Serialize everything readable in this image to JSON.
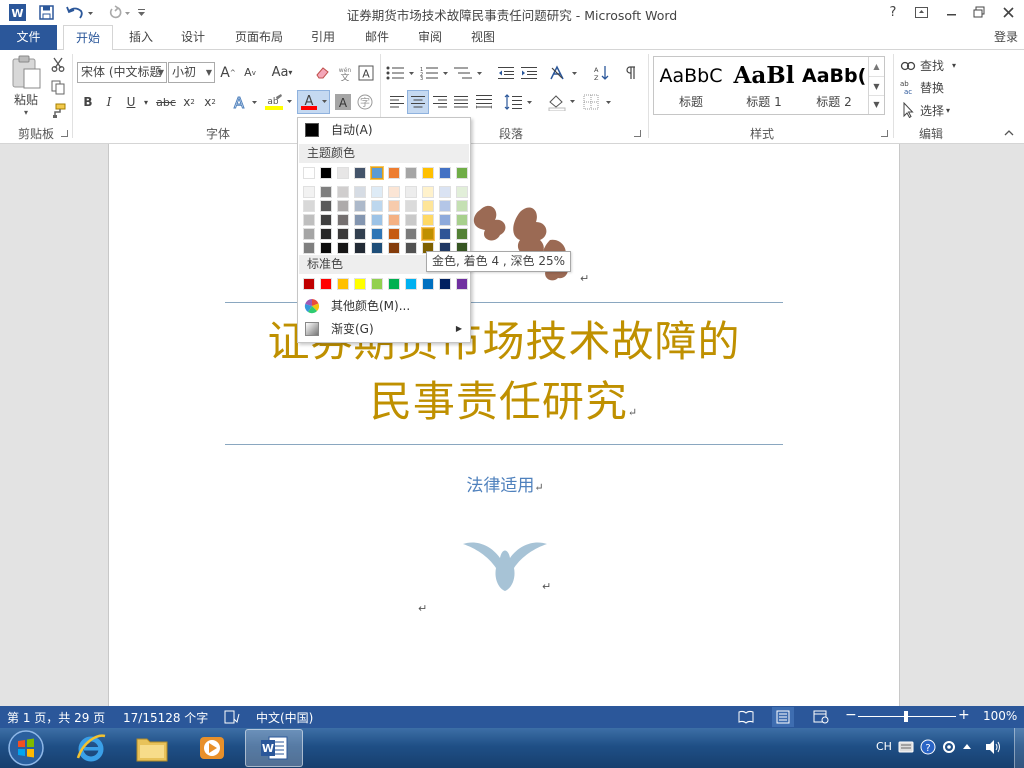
{
  "window": {
    "title": "证券期货市场技术故障民事责任问题研究 - Microsoft Word",
    "help_glyph": "?",
    "login": "登录"
  },
  "tabs": [
    {
      "label": "文件"
    },
    {
      "label": "开始"
    },
    {
      "label": "插入"
    },
    {
      "label": "设计"
    },
    {
      "label": "页面布局"
    },
    {
      "label": "引用"
    },
    {
      "label": "邮件"
    },
    {
      "label": "审阅"
    },
    {
      "label": "视图"
    }
  ],
  "ribbon": {
    "clipboard": {
      "paste_label": "粘贴",
      "group_label": "剪贴板"
    },
    "font": {
      "font_name": "宋体 (中文标题",
      "font_size": "小初",
      "grow_label": "A",
      "shrink_label": "A",
      "case_label": "Aa",
      "bold": "B",
      "italic": "I",
      "underline": "U",
      "strike": "abc",
      "subscript": "x",
      "superscript": "x",
      "group_label": "字体"
    },
    "paragraph": {
      "group_label": "段落"
    },
    "styles": {
      "items": [
        {
          "sample": "AaBbC",
          "name": "标题"
        },
        {
          "sample": "AaBl",
          "name": "标题 1"
        },
        {
          "sample": "AaBb(",
          "name": "标题 2"
        }
      ],
      "group_label": "样式"
    },
    "editing": {
      "find": "查找",
      "replace": "替换",
      "select": "选择",
      "group_label": "编辑"
    }
  },
  "color_menu": {
    "auto_label": "自动(A)",
    "theme_header": "主题颜色",
    "standard_header": "标准色",
    "more_colors": "其他颜色(M)...",
    "gradient": "渐变(G)",
    "theme_top": [
      "#ffffff",
      "#000000",
      "#e7e6e6",
      "#44546a",
      "#5b9bd5",
      "#ed7d31",
      "#a5a5a5",
      "#ffc000",
      "#4472c4",
      "#70ad47"
    ],
    "theme_shades": [
      [
        "#f2f2f2",
        "#7f7f7f",
        "#d0cece",
        "#d6dce4",
        "#deebf6",
        "#fbe5d5",
        "#ededed",
        "#fff2cc",
        "#dae3f3",
        "#e2efd9"
      ],
      [
        "#d8d8d8",
        "#595959",
        "#aeabab",
        "#adb9ca",
        "#bdd7ee",
        "#f7cbac",
        "#dbdbdb",
        "#fee599",
        "#b4c6e7",
        "#c5e0b3"
      ],
      [
        "#bfbfbf",
        "#3f3f3f",
        "#757070",
        "#8496b0",
        "#9dc3e6",
        "#f4b183",
        "#c9c9c9",
        "#ffd965",
        "#8eaadb",
        "#a8d08d"
      ],
      [
        "#a5a5a5",
        "#262626",
        "#3a3838",
        "#323f4f",
        "#2e75b5",
        "#c55a11",
        "#7b7b7b",
        "#bf9000",
        "#2f5496",
        "#538135"
      ],
      [
        "#7f7f7f",
        "#0c0c0c",
        "#171616",
        "#222a35",
        "#1e4e79",
        "#843c0b",
        "#525252",
        "#7f6000",
        "#1f3864",
        "#375623"
      ]
    ],
    "standard": [
      "#c00000",
      "#ff0000",
      "#ffc000",
      "#ffff00",
      "#92d050",
      "#00b050",
      "#00b0f0",
      "#0070c0",
      "#002060",
      "#7030a0"
    ],
    "tooltip": "金色, 着色 4 , 深色 25%"
  },
  "document": {
    "title_line1": "证券期货市场技术故障的",
    "title_line2": "民事责任研究",
    "subtitle": "法律适用",
    "title_color": "#bf9000",
    "subtitle_color": "#4f81bd"
  },
  "statusbar": {
    "page": "第 1 页，共 29 页",
    "words": "17/15128 个字",
    "language": "中文(中国)",
    "zoom": "100%"
  },
  "taskbar": {
    "tray_lang": "CH"
  }
}
